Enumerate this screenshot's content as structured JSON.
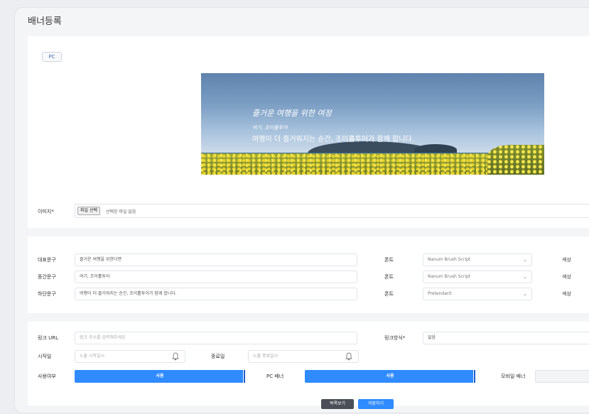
{
  "page": {
    "title": "배너등록"
  },
  "tabs": {
    "pc": "PC"
  },
  "banner": {
    "line_top": "즐거운 여행을 위한 여정",
    "line_mid": "여기, 조이홀투어",
    "line_bottom": "여행이 더 즐거워지는 순간, 조이홀투어가 함께 합니다."
  },
  "image_row": {
    "label": "이미지*",
    "choose_file": "파일 선택",
    "no_file": "선택된 파일 없음"
  },
  "text_rows": [
    {
      "label": "대표문구",
      "value": "즐거운 여행을 위한다면",
      "font_label": "폰트",
      "font": "Nanum Brush Script",
      "color_label": "색상"
    },
    {
      "label": "중간문구",
      "value": "여기, 조이홀투어",
      "font_label": "폰트",
      "font": "Nanum Brush Script",
      "color_label": "색상"
    },
    {
      "label": "하단문구",
      "value": "여행이 더 즐거워지는 순간, 조이홀투어가 함께 합니다.",
      "font_label": "폰트",
      "font": "Pretendard",
      "color_label": "색상"
    }
  ],
  "link": {
    "url_label": "링크 URL",
    "url_placeholder": "링크 주소를 입력해주세요",
    "method_label": "링크방식*",
    "method_value": "없음"
  },
  "dates": {
    "start_label": "시작일",
    "start_placeholder": "노출 시작일시",
    "end_label": "종료일",
    "end_placeholder": "노출 종료일시"
  },
  "usage": {
    "use_label": "사용여부",
    "use_value": "사용",
    "pc_label": "PC 배너",
    "pc_value": "사용",
    "mobile_label": "모바일 배너"
  },
  "actions": {
    "cancel": "목록보기",
    "save": "저장하기"
  },
  "colors": {
    "accent": "#2f8bff",
    "dark_button": "#4a4f57"
  }
}
